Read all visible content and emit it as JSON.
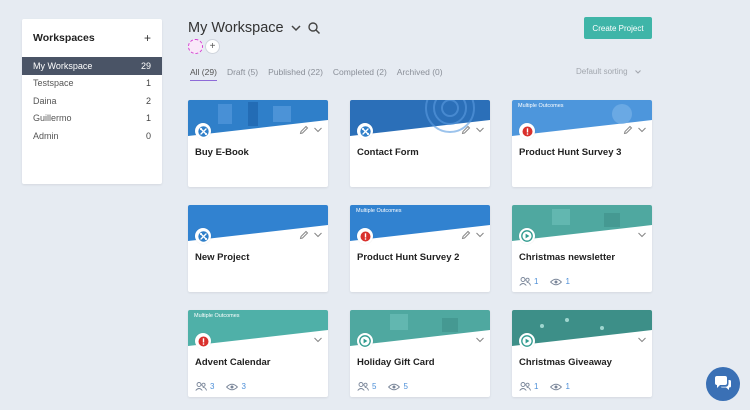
{
  "sidebar": {
    "title": "Workspaces",
    "add": "+",
    "items": [
      {
        "name": "My Workspace",
        "count": "29",
        "active": true
      },
      {
        "name": "Testspace",
        "count": "1",
        "active": false
      },
      {
        "name": "Daina",
        "count": "2",
        "active": false
      },
      {
        "name": "Guillermo",
        "count": "1",
        "active": false
      },
      {
        "name": "Admin",
        "count": "0",
        "active": false
      }
    ]
  },
  "header": {
    "title": "My Workspace",
    "create_label": "Create Project",
    "add_member": "+",
    "sorting": "Default sorting"
  },
  "tabs": [
    {
      "label": "All (29)",
      "active": true
    },
    {
      "label": "Draft (5)",
      "active": false
    },
    {
      "label": "Published (22)",
      "active": false
    },
    {
      "label": "Completed (2)",
      "active": false
    },
    {
      "label": "Archived (0)",
      "active": false
    }
  ],
  "colors": {
    "accent": "#3fb5a8",
    "sidebar_active": "#4a5466",
    "tab_underline": "#8e6bd8",
    "chat": "#3a70b5"
  },
  "cards": [
    {
      "name": "Buy E-Book",
      "status": "draft",
      "banner": "blue-pattern",
      "outcome": "",
      "edit": true,
      "participants": "",
      "views": ""
    },
    {
      "name": "Contact Form",
      "status": "draft",
      "banner": "blue-wave",
      "outcome": "",
      "edit": true,
      "participants": "",
      "views": ""
    },
    {
      "name": "Product Hunt Survey 3",
      "status": "alert",
      "banner": "sky",
      "outcome": "Multiple Outcomes",
      "edit": true,
      "participants": "",
      "views": ""
    },
    {
      "name": "New Project",
      "status": "draft",
      "banner": "blue",
      "outcome": "",
      "edit": true,
      "participants": "",
      "views": ""
    },
    {
      "name": "Product Hunt Survey 2",
      "status": "alert",
      "banner": "blue",
      "outcome": "Multiple Outcomes",
      "edit": true,
      "participants": "",
      "views": ""
    },
    {
      "name": "Christmas newsletter",
      "status": "published",
      "banner": "teal-gifts",
      "outcome": "",
      "edit": false,
      "participants": "1",
      "views": "1"
    },
    {
      "name": "Advent Calendar",
      "status": "alert",
      "banner": "teal",
      "outcome": "Multiple Outcomes",
      "edit": false,
      "participants": "3",
      "views": "3"
    },
    {
      "name": "Holiday Gift Card",
      "status": "published",
      "banner": "teal-gifts",
      "outcome": "",
      "edit": false,
      "participants": "5",
      "views": "5"
    },
    {
      "name": "Christmas Giveaway",
      "status": "published",
      "banner": "teal-dark",
      "outcome": "",
      "edit": false,
      "participants": "1",
      "views": "1"
    }
  ]
}
